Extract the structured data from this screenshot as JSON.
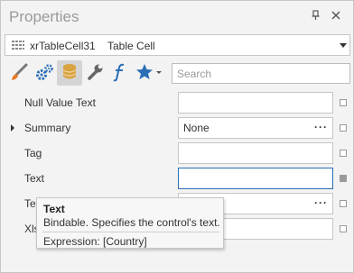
{
  "window": {
    "title": "Properties"
  },
  "selector": {
    "name": "xrTableCell31",
    "type": "Table Cell"
  },
  "toolbar": {
    "buttons": [
      {
        "icon": "brush-icon"
      },
      {
        "icon": "gears-icon"
      },
      {
        "icon": "database-icon"
      },
      {
        "icon": "wrench-icon"
      },
      {
        "icon": "function-icon"
      },
      {
        "icon": "star-icon"
      }
    ],
    "search_placeholder": "Search"
  },
  "properties": [
    {
      "label": "Null Value Text",
      "value": "",
      "expandable": false,
      "has_ellipsis": false
    },
    {
      "label": "Summary",
      "value": "None",
      "expandable": true,
      "has_ellipsis": true
    },
    {
      "label": "Tag",
      "value": "",
      "expandable": false,
      "has_ellipsis": false
    },
    {
      "label": "Text",
      "value": "",
      "expandable": false,
      "has_ellipsis": false,
      "focused": true
    },
    {
      "label": "Te",
      "value": "",
      "expandable": false,
      "has_ellipsis": true
    },
    {
      "label": "Xls",
      "value": "",
      "expandable": false,
      "has_ellipsis": false
    }
  ],
  "tooltip": {
    "title": "Text",
    "description": "Bindable. Specifies the control's text.",
    "expression": "Expression: [Country]"
  },
  "colors": {
    "accent": "#2b6fb6",
    "icon_orange": "#e87a27",
    "icon_blue": "#2b6fb6",
    "icon_gold": "#d9a441"
  }
}
